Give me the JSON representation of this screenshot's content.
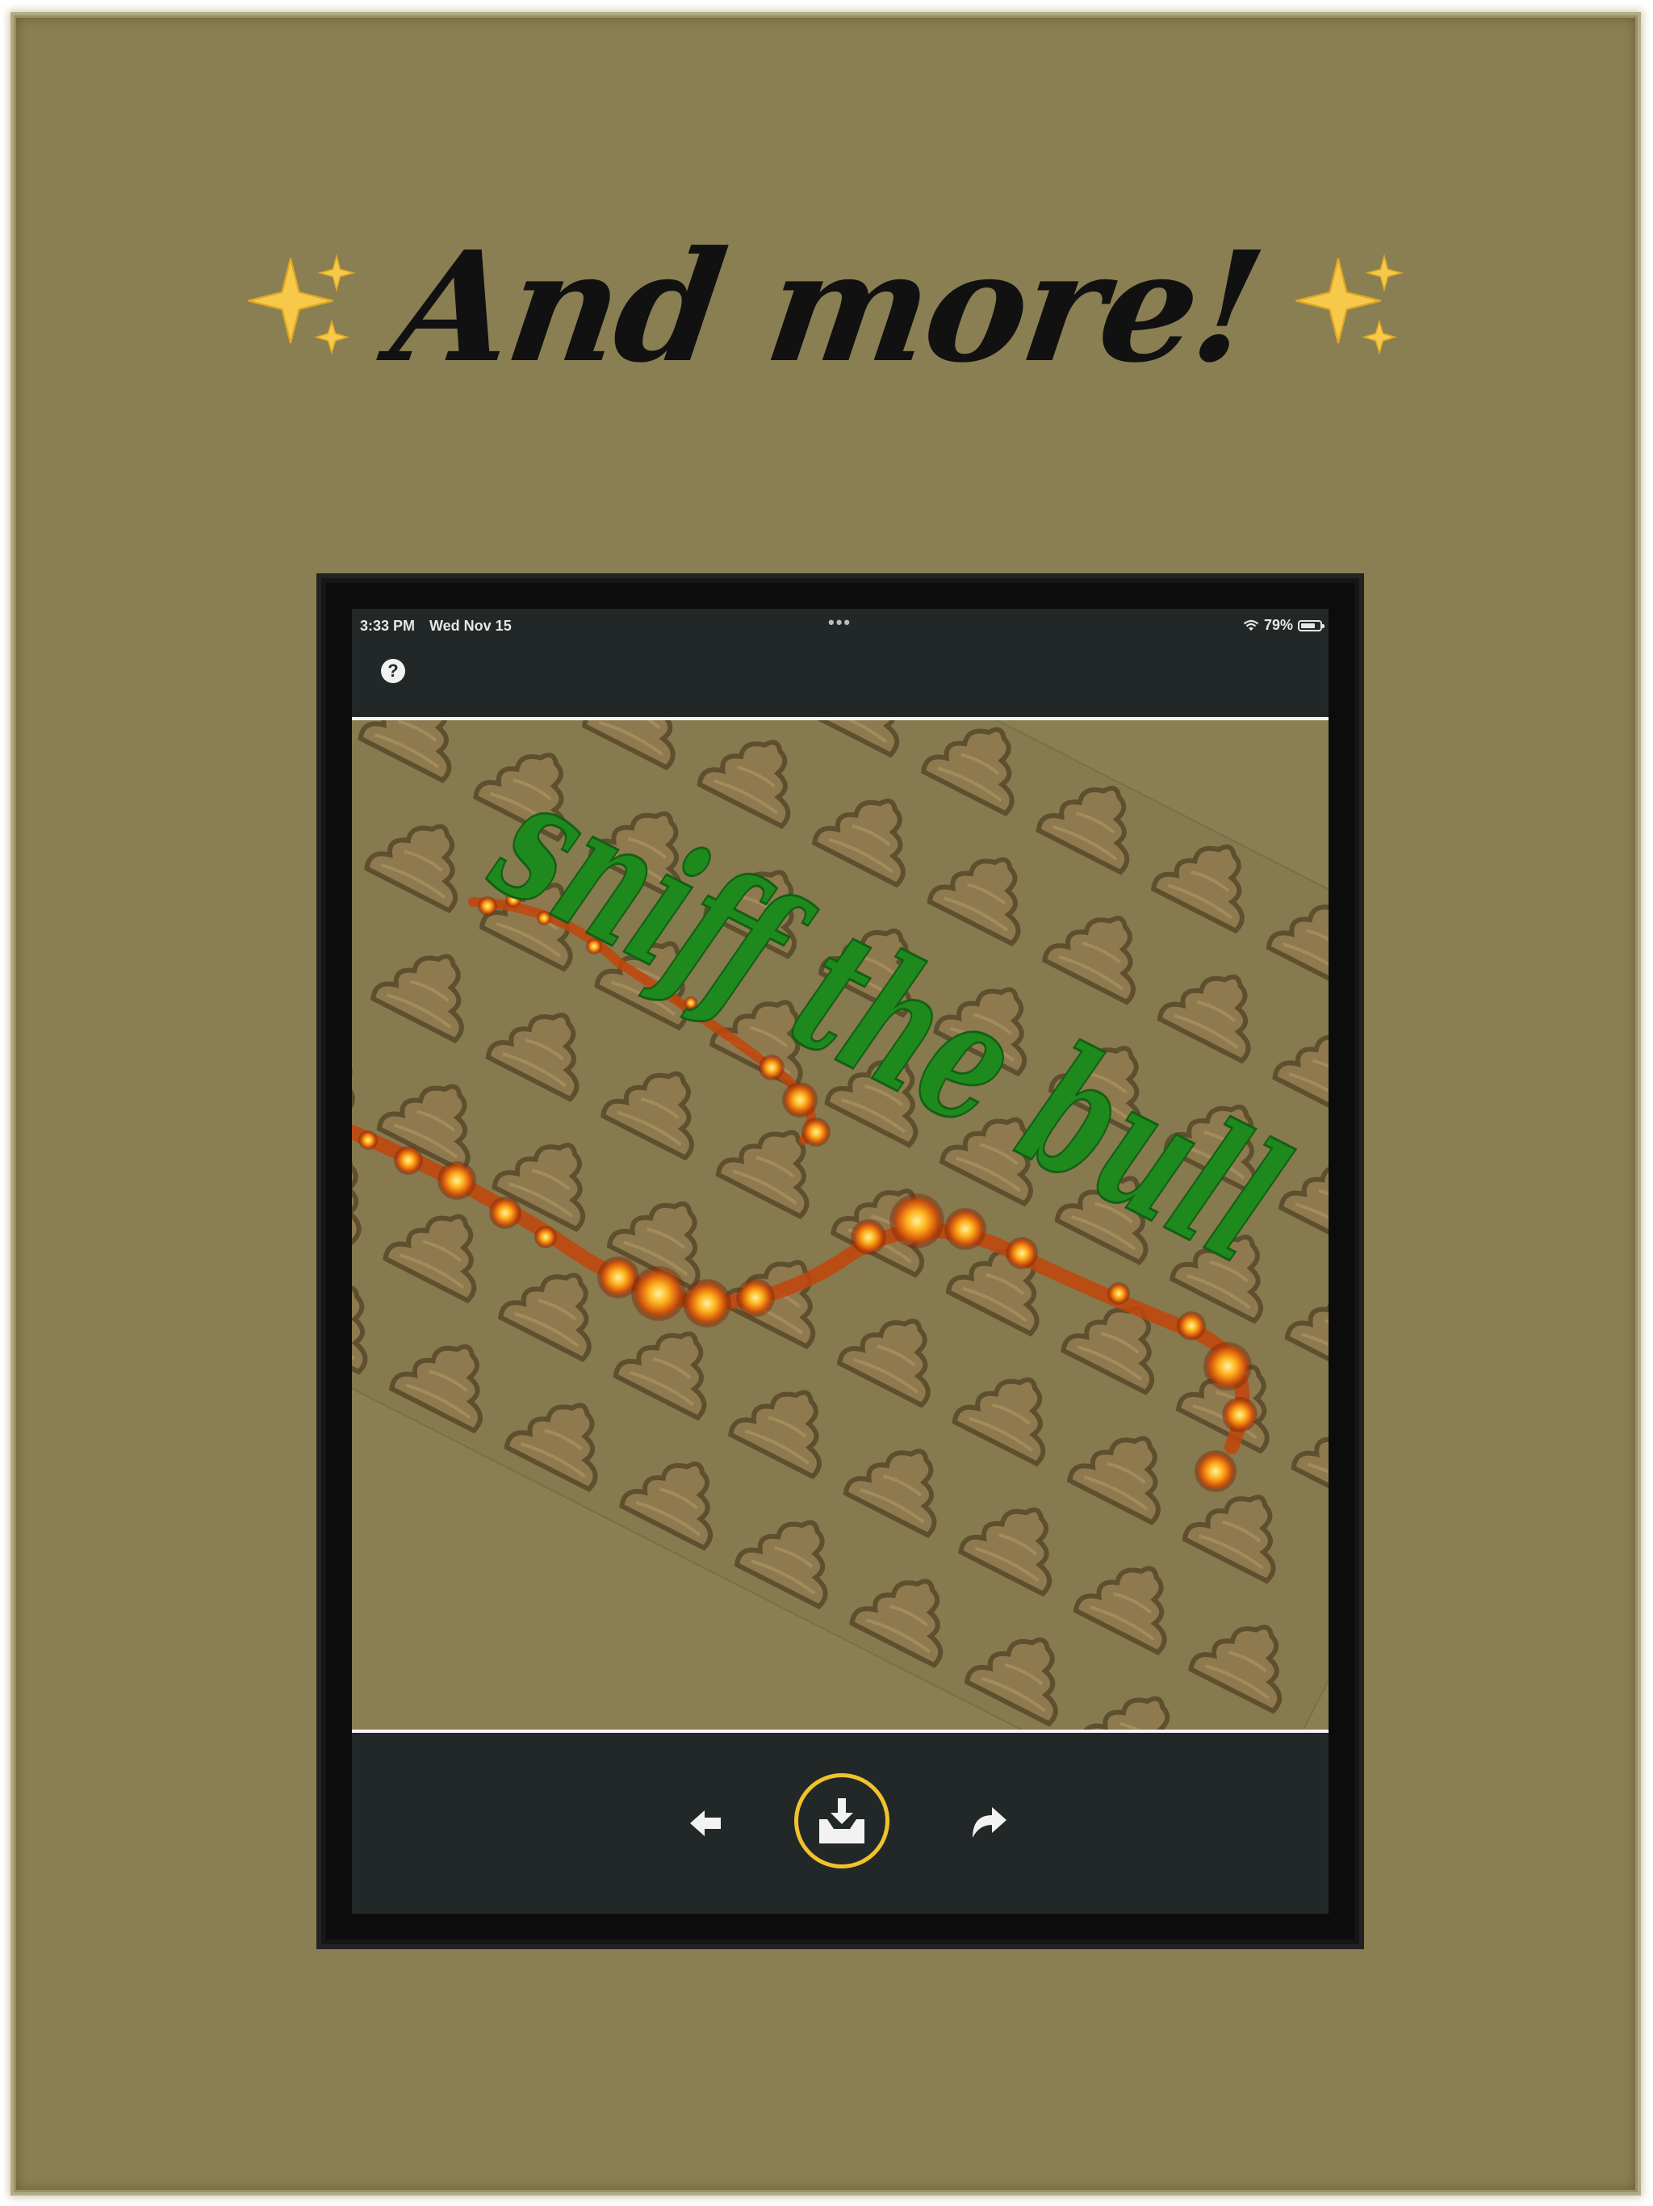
{
  "headline": {
    "text": "And more!",
    "sparkle_icon": "sparkles-icon"
  },
  "status_bar": {
    "time": "3:33 PM",
    "date": "Wed Nov 15",
    "battery_percent": "79%",
    "battery_level": 0.79,
    "wifi_icon": "wifi-icon",
    "battery_icon": "battery-icon"
  },
  "toolbar": {
    "help_label": "?",
    "help_icon": "question-circle-icon"
  },
  "canvas": {
    "caption": "sniff the bull",
    "caption_color": "#1e8a1e",
    "pattern_icon": "poop-emoji-icon",
    "effect": "fire-trail"
  },
  "bottom_bar": {
    "back_icon": "back-arrow-icon",
    "save_icon": "download-tray-icon",
    "forward_icon": "forward-arrow-icon",
    "accent_color": "#f0c22c"
  },
  "colors": {
    "background": "#8a7f52",
    "device_frame": "#0c0c0c",
    "app_bar": "#222828"
  }
}
